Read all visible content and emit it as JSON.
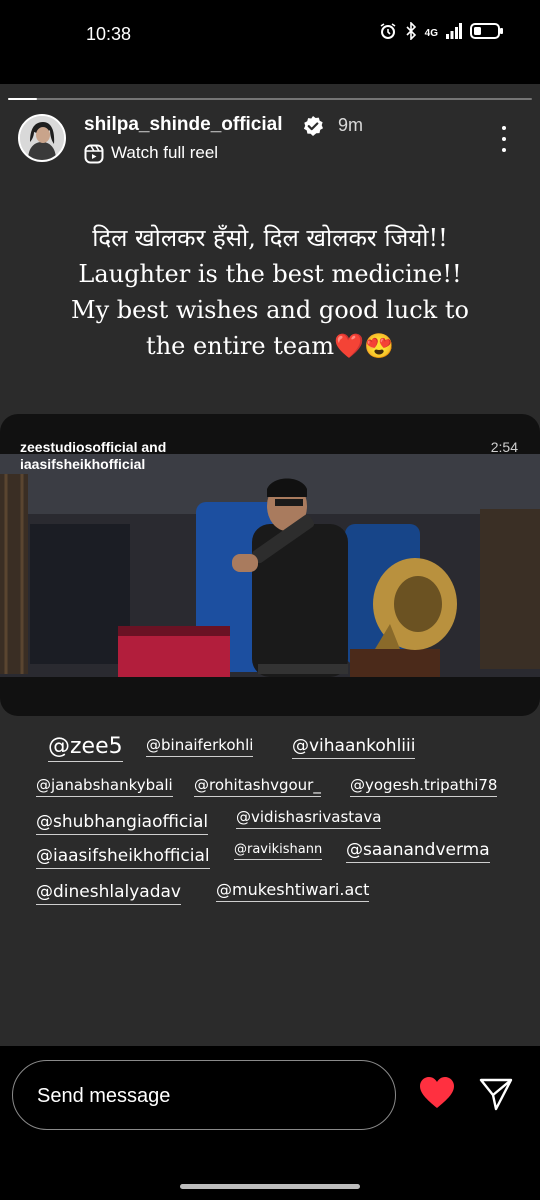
{
  "status_bar": {
    "time": "10:38",
    "network": "4G",
    "icons": [
      "alarm-icon",
      "bluetooth-icon",
      "signal-icon",
      "battery-icon"
    ]
  },
  "story": {
    "progress_fraction": 0.055,
    "username": "shilpa_shinde_official",
    "verified": true,
    "time_ago": "9m",
    "watch_reel_label": "Watch full reel",
    "caption": "दिल खोलकर हँसो, दिल खोलकर जियो!! Laughter is the best medicine!! My best wishes and good luck to the entire team❤️😍",
    "reel": {
      "title_line1": "zeestudiosofficial and",
      "title_line2": "iaasifsheikhofficial",
      "duration": "2:54"
    },
    "mentions": [
      "@zee5",
      "@binaiferkohli",
      "@vihaankohliii",
      "@janabshankybali",
      "@rohitashvgour_",
      "@yogesh.tripathi78",
      "@shubhangiaofficial",
      "@vidishasrivastava",
      "@iaasifsheikhofficial",
      "@ravikishann",
      "@saanandverma",
      "@dineshlalyadav",
      "@mukeshtiwari.act"
    ]
  },
  "footer": {
    "send_placeholder": "Send message"
  },
  "colors": {
    "story_bg": "#2b2b2b",
    "heart": "#ff3040",
    "page_bg": "#000000"
  }
}
